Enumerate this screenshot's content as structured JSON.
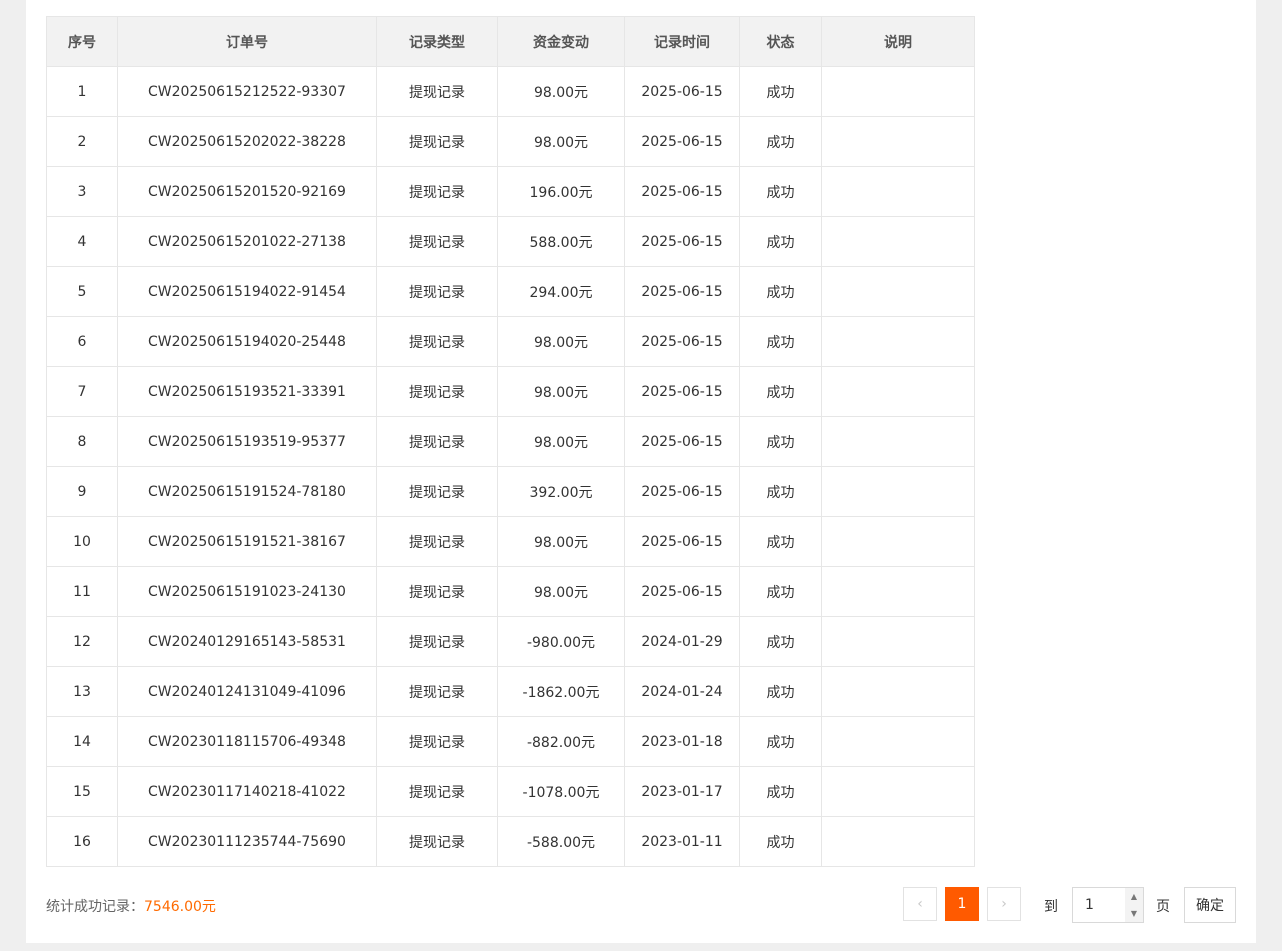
{
  "table": {
    "headers": {
      "index": "序号",
      "order_no": "订单号",
      "type": "记录类型",
      "amount": "资金变动",
      "time": "记录时间",
      "status": "状态",
      "note": "说明"
    },
    "rows": [
      {
        "index": "1",
        "order_no": "CW20250615212522-93307",
        "type": "提现记录",
        "amount": "98.00元",
        "time": "2025-06-15",
        "status": "成功",
        "note": "",
        "negative": false
      },
      {
        "index": "2",
        "order_no": "CW20250615202022-38228",
        "type": "提现记录",
        "amount": "98.00元",
        "time": "2025-06-15",
        "status": "成功",
        "note": "",
        "negative": false
      },
      {
        "index": "3",
        "order_no": "CW20250615201520-92169",
        "type": "提现记录",
        "amount": "196.00元",
        "time": "2025-06-15",
        "status": "成功",
        "note": "",
        "negative": false
      },
      {
        "index": "4",
        "order_no": "CW20250615201022-27138",
        "type": "提现记录",
        "amount": "588.00元",
        "time": "2025-06-15",
        "status": "成功",
        "note": "",
        "negative": false
      },
      {
        "index": "5",
        "order_no": "CW20250615194022-91454",
        "type": "提现记录",
        "amount": "294.00元",
        "time": "2025-06-15",
        "status": "成功",
        "note": "",
        "negative": false
      },
      {
        "index": "6",
        "order_no": "CW20250615194020-25448",
        "type": "提现记录",
        "amount": "98.00元",
        "time": "2025-06-15",
        "status": "成功",
        "note": "",
        "negative": false
      },
      {
        "index": "7",
        "order_no": "CW20250615193521-33391",
        "type": "提现记录",
        "amount": "98.00元",
        "time": "2025-06-15",
        "status": "成功",
        "note": "",
        "negative": false
      },
      {
        "index": "8",
        "order_no": "CW20250615193519-95377",
        "type": "提现记录",
        "amount": "98.00元",
        "time": "2025-06-15",
        "status": "成功",
        "note": "",
        "negative": false
      },
      {
        "index": "9",
        "order_no": "CW20250615191524-78180",
        "type": "提现记录",
        "amount": "392.00元",
        "time": "2025-06-15",
        "status": "成功",
        "note": "",
        "negative": false
      },
      {
        "index": "10",
        "order_no": "CW20250615191521-38167",
        "type": "提现记录",
        "amount": "98.00元",
        "time": "2025-06-15",
        "status": "成功",
        "note": "",
        "negative": false
      },
      {
        "index": "11",
        "order_no": "CW20250615191023-24130",
        "type": "提现记录",
        "amount": "98.00元",
        "time": "2025-06-15",
        "status": "成功",
        "note": "",
        "negative": false
      },
      {
        "index": "12",
        "order_no": "CW20240129165143-58531",
        "type": "提现记录",
        "amount": "-980.00元",
        "time": "2024-01-29",
        "status": "成功",
        "note": "",
        "negative": true
      },
      {
        "index": "13",
        "order_no": "CW20240124131049-41096",
        "type": "提现记录",
        "amount": "-1862.00元",
        "time": "2024-01-24",
        "status": "成功",
        "note": "",
        "negative": true
      },
      {
        "index": "14",
        "order_no": "CW20230118115706-49348",
        "type": "提现记录",
        "amount": "-882.00元",
        "time": "2023-01-18",
        "status": "成功",
        "note": "",
        "negative": true
      },
      {
        "index": "15",
        "order_no": "CW20230117140218-41022",
        "type": "提现记录",
        "amount": "-1078.00元",
        "time": "2023-01-17",
        "status": "成功",
        "note": "",
        "negative": true
      },
      {
        "index": "16",
        "order_no": "CW20230111235744-75690",
        "type": "提现记录",
        "amount": "-588.00元",
        "time": "2023-01-11",
        "status": "成功",
        "note": "",
        "negative": true
      }
    ]
  },
  "summary": {
    "label": "统计成功记录：",
    "amount": "7546.00元"
  },
  "pagination": {
    "prev_icon": "chevron-left-icon",
    "next_icon": "chevron-right-icon",
    "prev_glyph": "‹",
    "next_glyph": "›",
    "current_page": "1",
    "goto_label": "到",
    "goto_value": "1",
    "page_unit": "页",
    "confirm_label": "确定",
    "spin_up": "▲",
    "spin_down": "▼"
  },
  "colors": {
    "accent": "#ff5a00",
    "negative_amount": "#e8573e",
    "summary_amount": "#ff6a00"
  }
}
